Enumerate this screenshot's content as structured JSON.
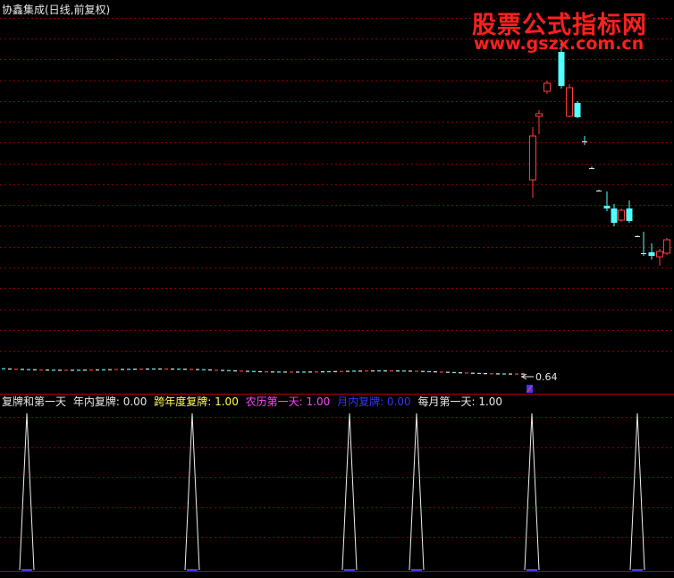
{
  "window": {
    "title": "协鑫集成(日线,前复权)",
    "watermark_cn": "股票公式指标网",
    "watermark_url": "www.gszx.com.cn"
  },
  "main_panel": {
    "price_label": "0.64"
  },
  "indicator_panel": {
    "legend": [
      {
        "label": "复牌和第一天",
        "color": "#e8e8e8"
      },
      {
        "label": "年内复牌: 0.00",
        "color": "#e8e8e8"
      },
      {
        "label": "跨年度复牌: 1.00",
        "color": "#ffff55"
      },
      {
        "label": "农历第一天: 1.00",
        "color": "#ff44ff"
      },
      {
        "label": "月内复牌: 0.00",
        "color": "#3333ff"
      },
      {
        "label": "每月第一天: 1.00",
        "color": "#e8e8e8"
      }
    ],
    "spike_count": 6
  },
  "colors": {
    "up": "#ff3b3b",
    "down": "#54ffff",
    "grid": "#8b0000",
    "border": "#a00000"
  }
}
